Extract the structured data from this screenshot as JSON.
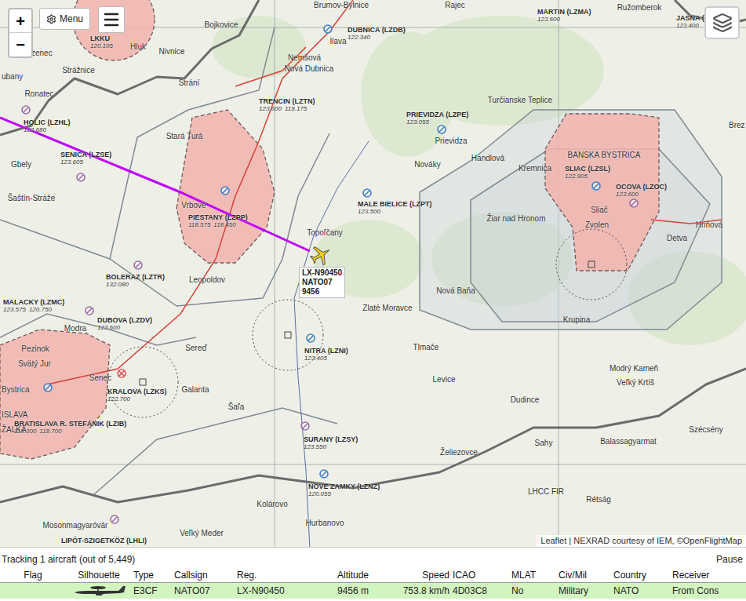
{
  "controls": {
    "zoom_in": "+",
    "zoom_out": "−",
    "menu": "Menu"
  },
  "map": {
    "towns": [
      "Brumov-Bylnice",
      "Rajec",
      "Ružomberok",
      "Bojkovice",
      "Hluk",
      "Nivnice",
      "ubany",
      "Bzenec",
      "Strážnice",
      "Strání",
      "Ronatec",
      "Ilava",
      "Nemšová",
      "Nová Dubnica",
      "Stará Turá",
      "Gbely",
      "Šaštín-Stráže",
      "Vrbové",
      "Topoľčany",
      "Prievidza",
      "Nováky",
      "Handlová",
      "Kremnica",
      "Turčianske Teplice",
      "Žiar nad Hronom",
      "Sliač",
      "Zvolen",
      "Detva",
      "Hriňová",
      "Brez",
      "Leopoldov",
      "Sereď",
      "Galanta",
      "Šaľa",
      "Modra",
      "Pezinok",
      "Svätý Jur",
      "Senec",
      "Bystrica",
      "ISLAVA",
      "ŽALKA",
      "Zlaté Moravce",
      "Nová Baňa",
      "Krupina",
      "Tlmače",
      "Levice",
      "Modrý Kameň",
      "Veľký Krtíš",
      "Dudince",
      "Sahy",
      "Balassagyarmat",
      "Szécsény",
      "Želiezovce",
      "Rétság",
      "Kolárovo",
      "Hurbanovo",
      "Mosonmagyaróvár",
      "Veľký Meder",
      "BANSKA BYSTRICA",
      "LHCC FIR"
    ],
    "airports": [
      {
        "name": "LKKU",
        "freqs": [
          "120.105"
        ],
        "kind": "none"
      },
      {
        "name": "HOLIC (LZHL)",
        "freqs": [
          "123.680"
        ],
        "kind": "ulm"
      },
      {
        "name": "SENICA (LZSE)",
        "freqs": [
          "123.605"
        ],
        "kind": "ulm"
      },
      {
        "name": "TRENCIN (LZTN)",
        "freqs": [
          "123.600",
          "119.175"
        ],
        "kind": "none"
      },
      {
        "name": "DUBNICA (LZDB)",
        "freqs": [
          "122.340"
        ],
        "kind": "civil"
      },
      {
        "name": "PRIEVIDZA (LZPE)",
        "freqs": [
          "123.055"
        ],
        "kind": "civil"
      },
      {
        "name": "MALE BIELICE (LZPT)",
        "freqs": [
          "123.500"
        ],
        "kind": "civil"
      },
      {
        "name": "MARTIN (LZMA)",
        "freqs": [
          "123.600"
        ],
        "kind": "none"
      },
      {
        "name": "JASNA (LZ",
        "freqs": [
          "123.400"
        ],
        "kind": "none"
      },
      {
        "name": "PIESTANY (LZPP)",
        "freqs": [
          "118.575",
          "118.450"
        ],
        "kind": "civil"
      },
      {
        "name": "BOLERAZ (LZTR)",
        "freqs": [
          "132.080"
        ],
        "kind": "ulm"
      },
      {
        "name": "MALACKY (LZMC)",
        "freqs": [
          "123.575",
          "120.750"
        ],
        "kind": "none"
      },
      {
        "name": "DUBOVA (LZDV)",
        "freqs": [
          "123.600"
        ],
        "kind": "ulm"
      },
      {
        "name": "KRALOVA (LZKS)",
        "freqs": [
          "122.700"
        ],
        "kind": "closed"
      },
      {
        "name": "BRATISLAVA R. STEFÁNIK (LZIB)",
        "freqs": [
          "118.300",
          "118.700"
        ],
        "kind": "civil"
      },
      {
        "name": "NITRA (LZNI)",
        "freqs": [
          "123.405"
        ],
        "kind": "civil"
      },
      {
        "name": "SURANY (LZSY)",
        "freqs": [
          "123.550"
        ],
        "kind": "ulm"
      },
      {
        "name": "NOVE ZAMKY (LZNZ)",
        "freqs": [
          "120.055"
        ],
        "kind": "civil"
      },
      {
        "name": "SLIAC (LZSL)",
        "freqs": [
          "122.905"
        ],
        "kind": "civil"
      },
      {
        "name": "OCOVA (LZOC)",
        "freqs": [
          "123.600"
        ],
        "kind": "ulm"
      },
      {
        "name": "LIPÓT-SZIGETKÖZ (LHLI)",
        "freqs": [],
        "kind": "ulm"
      }
    ],
    "attribution": "Leaflet | NEXRAD courtesy of IEM, ©OpenFlightMap"
  },
  "aircraft": {
    "reg": "LX-N90450",
    "callsign": "NATO07",
    "altitude": "9456"
  },
  "panel": {
    "status": "Tracking 1 aircraft (out of 5,449)",
    "pause": "Pause",
    "columns": [
      "Flag",
      "Silhouette",
      "Type",
      "Callsign",
      "Reg.",
      "Altitude",
      "Speed",
      "ICAO",
      "MLAT",
      "Civ/Mil",
      "Country",
      "Receiver"
    ],
    "rows": [
      {
        "type": "E3CF",
        "callsign": "NATO07",
        "reg": "LX-N90450",
        "altitude": "9456 m",
        "speed": "753.8 km/h",
        "icao": "4D03C8",
        "mlat": "No",
        "civmil": "Military",
        "country": "NATO",
        "receiver": "From Cons",
        "selected": true
      }
    ]
  }
}
